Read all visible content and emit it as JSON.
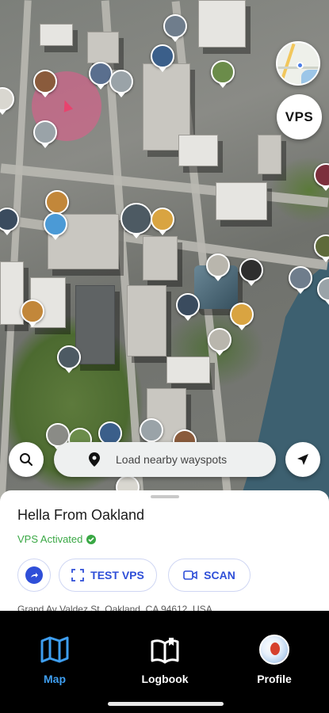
{
  "map": {
    "vps_button_label": "VPS",
    "search_bar_label": "Load nearby wayspots",
    "pin_colors": [
      "#3b5f8a",
      "#c2873a",
      "#5a6f8e",
      "#8a5b3c",
      "#4b9ad6",
      "#2e2e2e",
      "#9aa3a8",
      "#6b8c4a",
      "#d9a441",
      "#3a4b5e"
    ]
  },
  "wayspot": {
    "title": "Hella From Oakland",
    "vps_status": "VPS Activated",
    "vps_status_color": "#3aa845",
    "test_vps_label": "TEST VPS",
    "scan_label": "SCAN",
    "address": "Grand Av Valdez St, Oakland, CA 94612, USA",
    "accent_color": "#2f4fd8"
  },
  "tabs": [
    {
      "label": "Map",
      "icon": "map-icon",
      "active": true
    },
    {
      "label": "Logbook",
      "icon": "book-icon",
      "active": false
    },
    {
      "label": "Profile",
      "icon": "avatar",
      "active": false
    }
  ]
}
